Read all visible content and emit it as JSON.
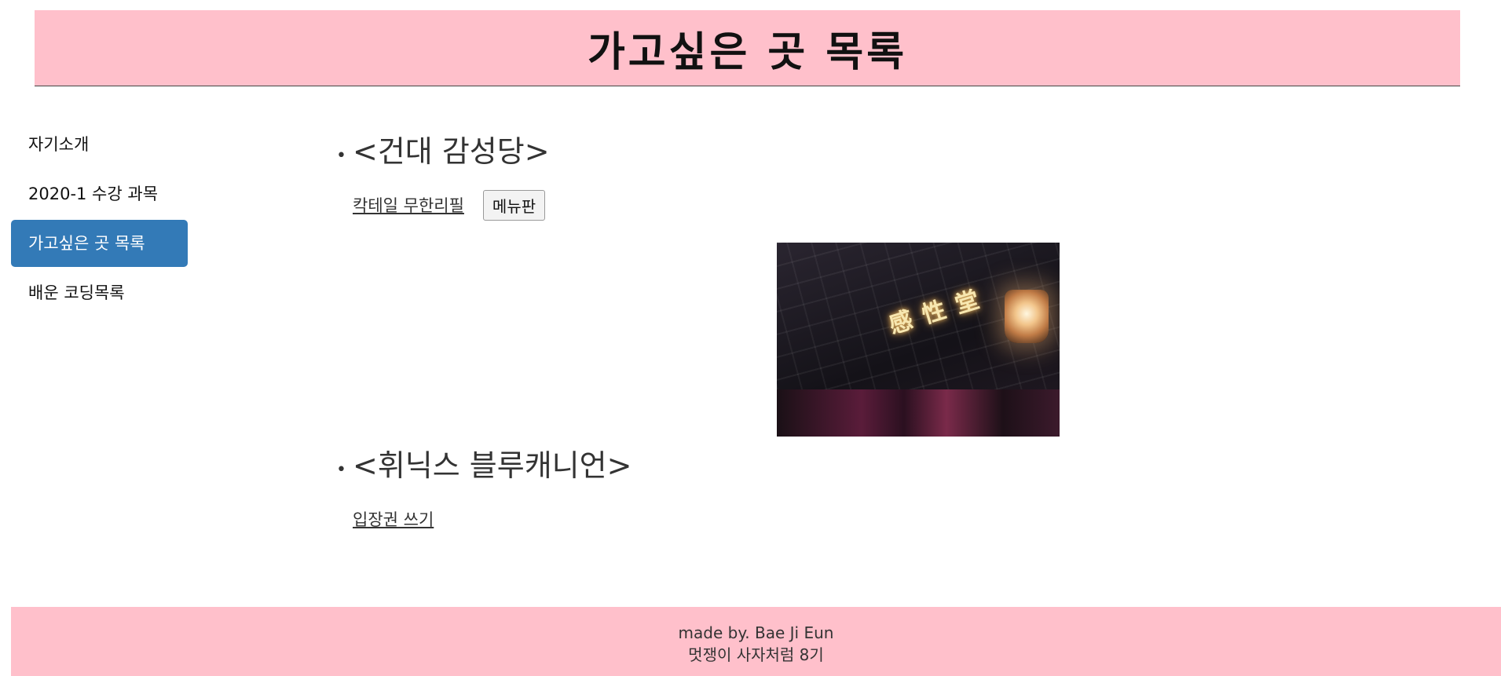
{
  "header": {
    "title": "가고싶은 곳 목록"
  },
  "sidebar": {
    "items": [
      {
        "label": "자기소개"
      },
      {
        "label": "2020-1 수강 과목"
      },
      {
        "label": "가고싶은 곳 목록"
      },
      {
        "label": "배운 코딩목록"
      }
    ],
    "active_index": 2
  },
  "places": [
    {
      "title": "<건대 감성당>",
      "link_label": "칵테일 무한리필",
      "button_label": "메뉴판",
      "photo": {
        "sign_text": "感性堂"
      }
    },
    {
      "title": "<휘닉스 블루캐니언>",
      "link_label": "입장권 쓰기"
    }
  ],
  "footer": {
    "line1": "made by. Bae Ji Eun",
    "line2": "멋쟁이 사자처럼 8기"
  },
  "colors": {
    "header_bg": "#ffc0cb",
    "footer_bg": "#ffc0cb",
    "active_nav_bg": "#337ab7"
  }
}
